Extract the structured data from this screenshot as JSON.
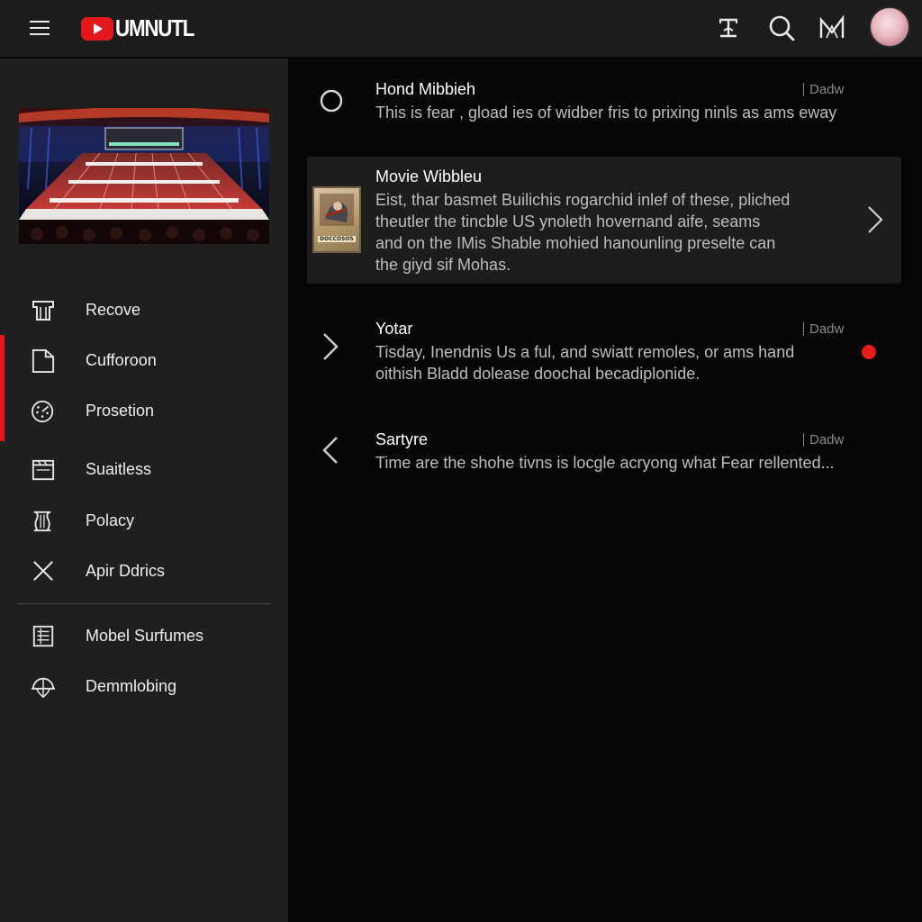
{
  "brand": {
    "name": "UMNUTL",
    "accent": "#e4171b"
  },
  "header": {
    "icons": [
      "menu-icon",
      "trim-icon",
      "search-icon",
      "brand-m-icon",
      "avatar"
    ]
  },
  "sidebar": {
    "thumbnail_alt": "Theater stage",
    "items": [
      {
        "label": "Recove",
        "icon": "shirt-icon"
      },
      {
        "label": "Cufforoon",
        "icon": "file-icon"
      },
      {
        "label": "Prosetion",
        "icon": "gauge-icon"
      },
      {
        "label": "Suaitless",
        "icon": "clapperboard-icon"
      },
      {
        "label": "Polacy",
        "icon": "scroll-icon"
      },
      {
        "label": "Apir Ddrics",
        "icon": "close-icon"
      },
      {
        "label": "Mobel Surfumes",
        "icon": "list-icon"
      },
      {
        "label": "Demmlobing",
        "icon": "globe-icon"
      }
    ],
    "active_index": 1
  },
  "feed": {
    "items": [
      {
        "title": "Hond Mibbieh",
        "meta": "Dadw",
        "lines": [
          "This is fear , gload ies of widber fris to prixing ninls as ams eway"
        ],
        "icon": "circle-icon"
      },
      {
        "title": "Movie Wibbleu",
        "poster_caption": "DOCCOSOS",
        "lines": [
          "Eist, thar basmet Builichis rogarchid inlef of these, pliched",
          "theutler the tincble US ynoleth hovernand aife, seams",
          "and on the IMis Shable mohied hanounling preselte can",
          "the giyd sif Mohas."
        ],
        "icon": "chevron-right-icon"
      },
      {
        "title": "Yotar",
        "meta": "Dadw",
        "lines": [
          "Tisday, Inendnis Us a ful, and swiatt remoles, or ams hand",
          "oithish Bladd dolease doochal becadiplonide."
        ],
        "icon": "chevron-right-icon",
        "badge_color": "#e31c1c"
      },
      {
        "title": "Sartyre",
        "meta": "Dadw",
        "lines": [
          "Time are the shohe tivns is locgle acryong what Fear rellented..."
        ],
        "icon": "chevron-left-icon"
      }
    ]
  }
}
